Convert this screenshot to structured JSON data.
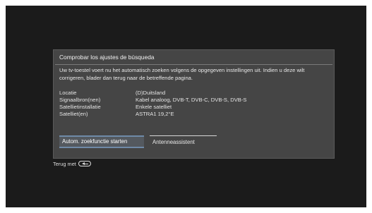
{
  "dialog": {
    "title": "Comprobar los ajustes de búsqueda",
    "description": "Uw tv-toestel voert nu het automatisch zoeken volgens de opgegeven instellingen uit. Indien u deze wilt corrigeren, blader dan terug naar de betreffende pagina.",
    "settings": [
      {
        "label": "Locatie",
        "value": "(D)Duitsland"
      },
      {
        "label": "Signaalbron(nen)",
        "value": "Kabel analoog, DVB-T, DVB-C, DVB-S, DVB-S"
      },
      {
        "label": "Satellietinstallatie",
        "value": "Enkele satelliet"
      },
      {
        "label": "Satelliet(en)",
        "value": "ASTRA1 19,2°E"
      }
    ],
    "buttons": {
      "start": "Autom. zoekfunctie starten",
      "antenna": "Antenneassistent"
    }
  },
  "footer": {
    "back_text": "Terug met",
    "back_icon": "back-key-icon"
  }
}
